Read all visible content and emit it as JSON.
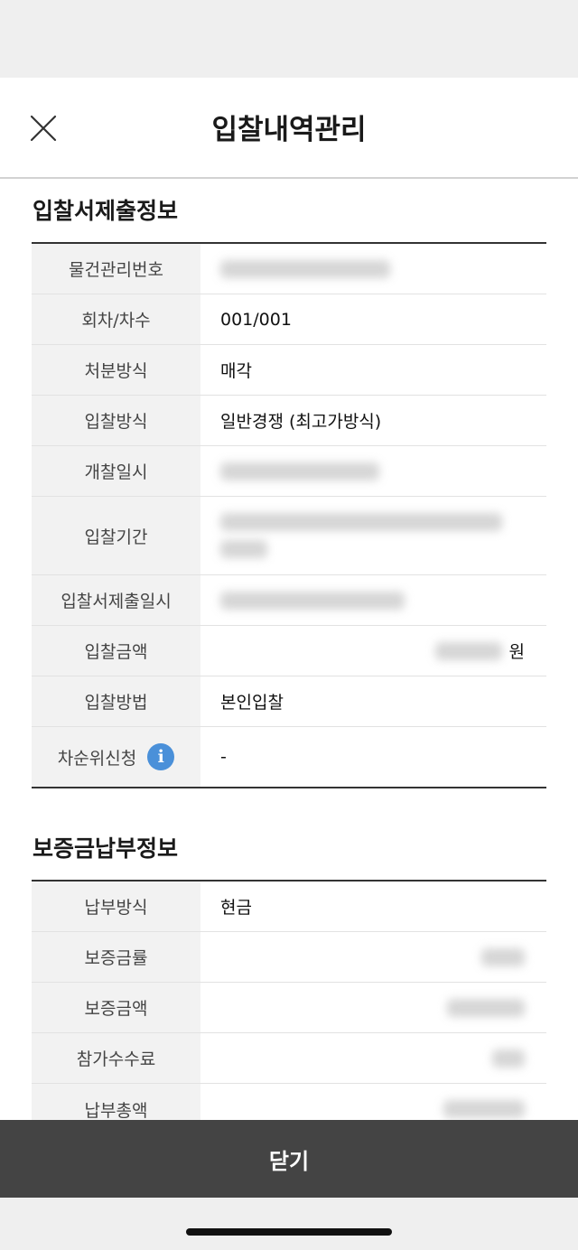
{
  "header": {
    "title": "입찰내역관리"
  },
  "bid_info": {
    "section_title": "입찰서제출정보",
    "rows": {
      "item_number": {
        "label": "물건관리번호"
      },
      "round": {
        "label": "회차/차수",
        "value": "001/001"
      },
      "disposal_method": {
        "label": "처분방식",
        "value": "매각"
      },
      "bid_method": {
        "label": "입찰방식",
        "value": "일반경쟁 (최고가방식)"
      },
      "opening_date": {
        "label": "개찰일시"
      },
      "bid_period": {
        "label": "입찰기간"
      },
      "submission_date": {
        "label": "입찰서제출일시"
      },
      "bid_amount": {
        "label": "입찰금액",
        "unit": "원"
      },
      "bid_manner": {
        "label": "입찰방법",
        "value": "본인입찰"
      },
      "round_request": {
        "label": "차순위신청",
        "value": "-"
      }
    }
  },
  "deposit_info": {
    "section_title": "보증금납부정보",
    "rows": {
      "payment_method": {
        "label": "납부방식",
        "value": "현금"
      },
      "deposit_rate": {
        "label": "보증금률"
      },
      "deposit_amount": {
        "label": "보증금액"
      },
      "participation_fee": {
        "label": "참가수수료"
      },
      "total_payment": {
        "label": "납부총액"
      }
    }
  },
  "footer": {
    "close_label": "닫기"
  }
}
